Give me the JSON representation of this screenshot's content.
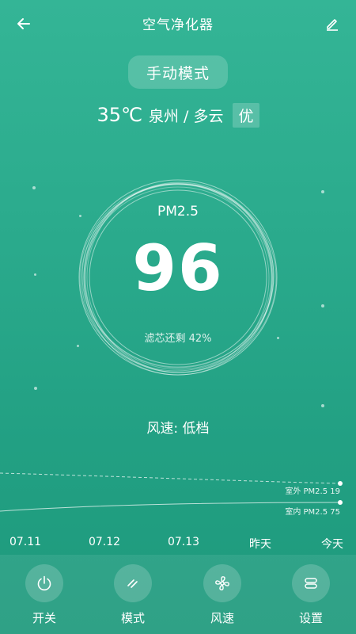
{
  "header": {
    "title": "空气净化器",
    "back_icon": "arrow-left-icon",
    "edit_icon": "pencil-icon"
  },
  "mode": {
    "label": "手动模式"
  },
  "weather": {
    "temperature": "35℃",
    "location": "泉州 / 多云",
    "air_quality": "优"
  },
  "reading": {
    "label": "PM2.5",
    "value": "96",
    "filter_text": "滤芯还剩 42%",
    "filter_remaining_percent": 42
  },
  "fan": {
    "text": "风速: 低档"
  },
  "trend": {
    "outdoor_label": "室外 PM2.5 19",
    "indoor_label": "室内 PM2.5 75",
    "dates": [
      "07.11",
      "07.12",
      "07.13",
      "昨天",
      "今天"
    ]
  },
  "nav": [
    {
      "label": "开关",
      "icon": "power-icon"
    },
    {
      "label": "模式",
      "icon": "mode-slash-icon"
    },
    {
      "label": "风速",
      "icon": "fan-icon"
    },
    {
      "label": "设置",
      "icon": "settings-icon"
    }
  ],
  "colors": {
    "background_top": "#34b596",
    "background_bottom": "#1e9a7c",
    "text": "#ffffff"
  }
}
